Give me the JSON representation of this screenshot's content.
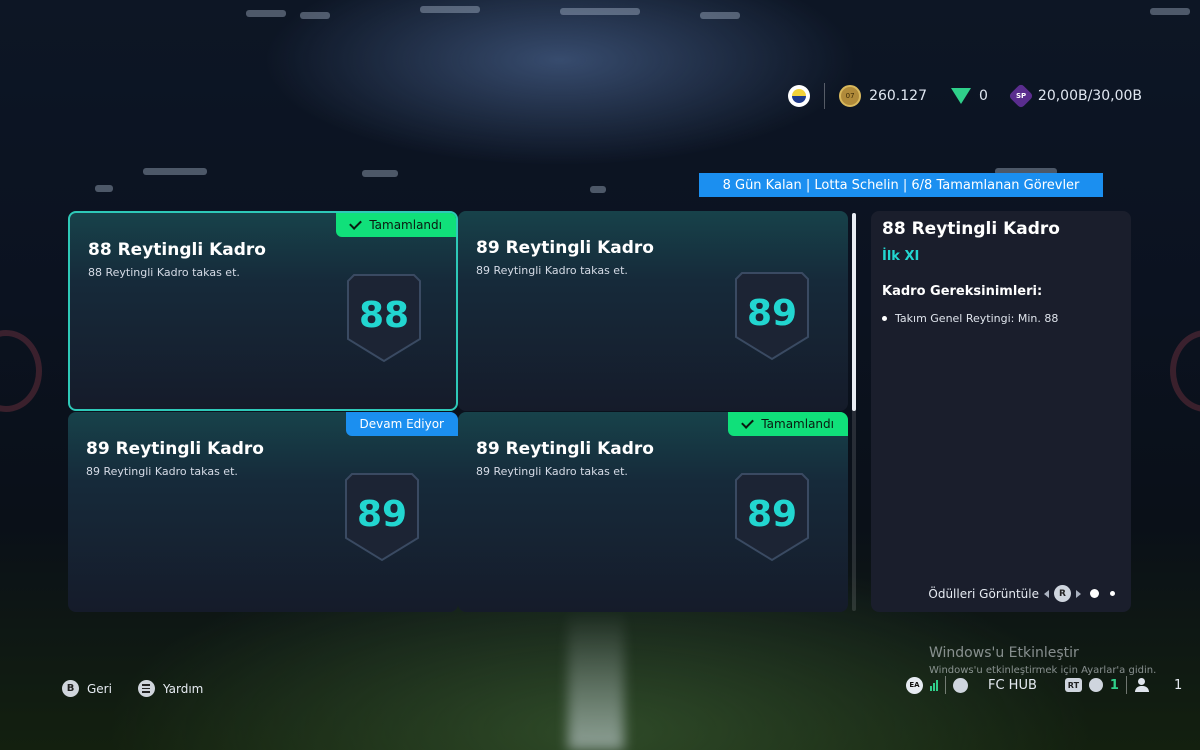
{
  "top_bar": {
    "club_icon": "fenerbahce-badge-icon",
    "coins": "260.127",
    "points": "0",
    "season_progress": "20,00B/30,00B"
  },
  "objective_banner": "8 Gün Kalan | Lotta Schelin | 6/8 Tamamlanan Görevler",
  "cards": [
    {
      "title": "88 Reytingli Kadro",
      "subtitle": "88 Reytingli Kadro takas et.",
      "rating": "88",
      "status": "Tamamlandı",
      "status_type": "done",
      "selected": true
    },
    {
      "title": "89 Reytingli Kadro",
      "subtitle": "89 Reytingli Kadro takas et.",
      "rating": "89",
      "status": "",
      "status_type": "none",
      "selected": false
    },
    {
      "title": "89 Reytingli Kadro",
      "subtitle": "89 Reytingli Kadro takas et.",
      "rating": "89",
      "status": "Devam Ediyor",
      "status_type": "in-progress",
      "selected": false
    },
    {
      "title": "89 Reytingli Kadro",
      "subtitle": "89 Reytingli Kadro takas et.",
      "rating": "89",
      "status": "Tamamlandı",
      "status_type": "done",
      "selected": false
    }
  ],
  "detail_panel": {
    "title": "88 Reytingli Kadro",
    "category": "İlk XI",
    "requirements_heading": "Kadro Gereksinimleri:",
    "requirements": [
      "Takım Genel Reytingi: Min. 88"
    ],
    "view_rewards": "Ödülleri Görüntüle",
    "rewards_button": "R"
  },
  "bottom_controls": {
    "back_button": "B",
    "back_label": "Geri",
    "help_label": "Yardım"
  },
  "watermark": {
    "title": "Windows'u Etkinleştir",
    "subtitle": "Windows'u etkinleştirmek için Ayarlar'a gidin."
  },
  "status_bar": {
    "ea_label": "EA",
    "hub_label": "FC HUB",
    "rt_label": "RT",
    "voice_count": "1",
    "party_count": "1"
  },
  "colors": {
    "accent_teal": "#22d6d0",
    "done_green": "#10e07a",
    "progress_blue": "#1b8ff0"
  }
}
